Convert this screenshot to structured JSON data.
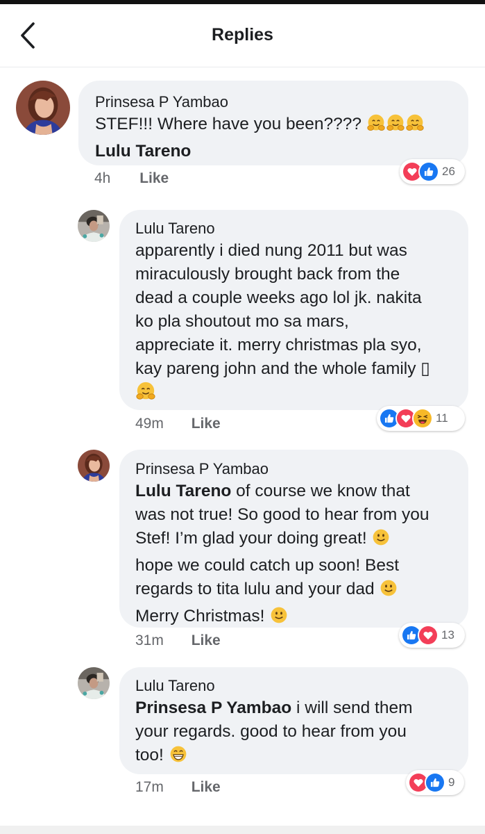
{
  "header": {
    "title": "Replies"
  },
  "comments": [
    {
      "author": "Prinsesa P Yambao",
      "text": "STEF!!! Where have you been????",
      "tag": "Lulu Tareno",
      "time": "4h",
      "like_label": "Like",
      "reaction_count": "26",
      "reactions": [
        "love",
        "like"
      ]
    },
    {
      "author": "Lulu Tareno",
      "lines": [
        "apparently i died nung 2011 but was",
        "miraculously brought back from the",
        "dead a couple weeks ago lol jk. nakita",
        "ko pla shoutout mo sa mars,",
        "appreciate it. merry christmas pla syo,",
        "kay pareng john and the whole family ▯"
      ],
      "time": "49m",
      "like_label": "Like",
      "reaction_count": "11",
      "reactions": [
        "like",
        "love",
        "haha"
      ]
    },
    {
      "author": "Prinsesa P Yambao",
      "mention": "Lulu Tareno",
      "lines": [
        " of course we know that",
        "was not true! So good to hear from you",
        "Stef! I’m glad your doing great!",
        "hope we could catch up soon! Best",
        "regards to tita lulu and your dad",
        "Merry Christmas!"
      ],
      "time": "31m",
      "like_label": "Like",
      "reaction_count": "13",
      "reactions": [
        "like",
        "love"
      ]
    },
    {
      "author": "Lulu Tareno",
      "mention": "Prinsesa P Yambao",
      "lines": [
        " i will send them",
        "your regards. good to hear from you",
        "too!"
      ],
      "time": "17m",
      "like_label": "Like",
      "reaction_count": "9",
      "reactions": [
        "love",
        "like"
      ]
    }
  ],
  "colors": {
    "like": "#1877f2",
    "love": "#f33e58",
    "haha": "#f7b928",
    "bubble": "#f0f2f5"
  },
  "icons": {
    "back": "chevron-left-icon",
    "hug": "hugging-face-emoji",
    "smile": "smiling-face-emoji",
    "grin": "grinning-face-emoji"
  }
}
